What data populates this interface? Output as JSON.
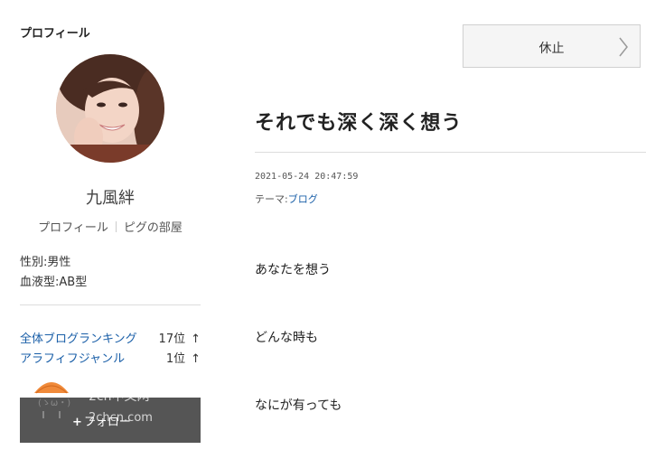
{
  "sidebar": {
    "heading": "プロフィール",
    "name": "九風絆",
    "links": [
      "プロフィール",
      "ピグの部屋"
    ],
    "gender": "性別:男性",
    "blood_type": "血液型:AB型",
    "rankings": [
      {
        "label": "全体ブログランキング",
        "value": "17位",
        "arrow": "↑"
      },
      {
        "label": "アラフィフジャンル",
        "value": "1位",
        "arrow": "↑"
      }
    ],
    "follow_label": "フォロー",
    "watermark_line1": "2ch中文网",
    "watermark_line2": "2chcn.com"
  },
  "header": {
    "halt_button": "休止"
  },
  "entry": {
    "title": "それでも深く深く想う",
    "date": "2021-05-24 20:47:59",
    "theme_prefix": "テーマ:",
    "theme_link": "ブログ",
    "lines": [
      "あなたを想う",
      "どんな時も",
      "なにが有っても"
    ]
  },
  "colors": {
    "link": "#1a5fa8",
    "follow_bg": "#555555"
  }
}
